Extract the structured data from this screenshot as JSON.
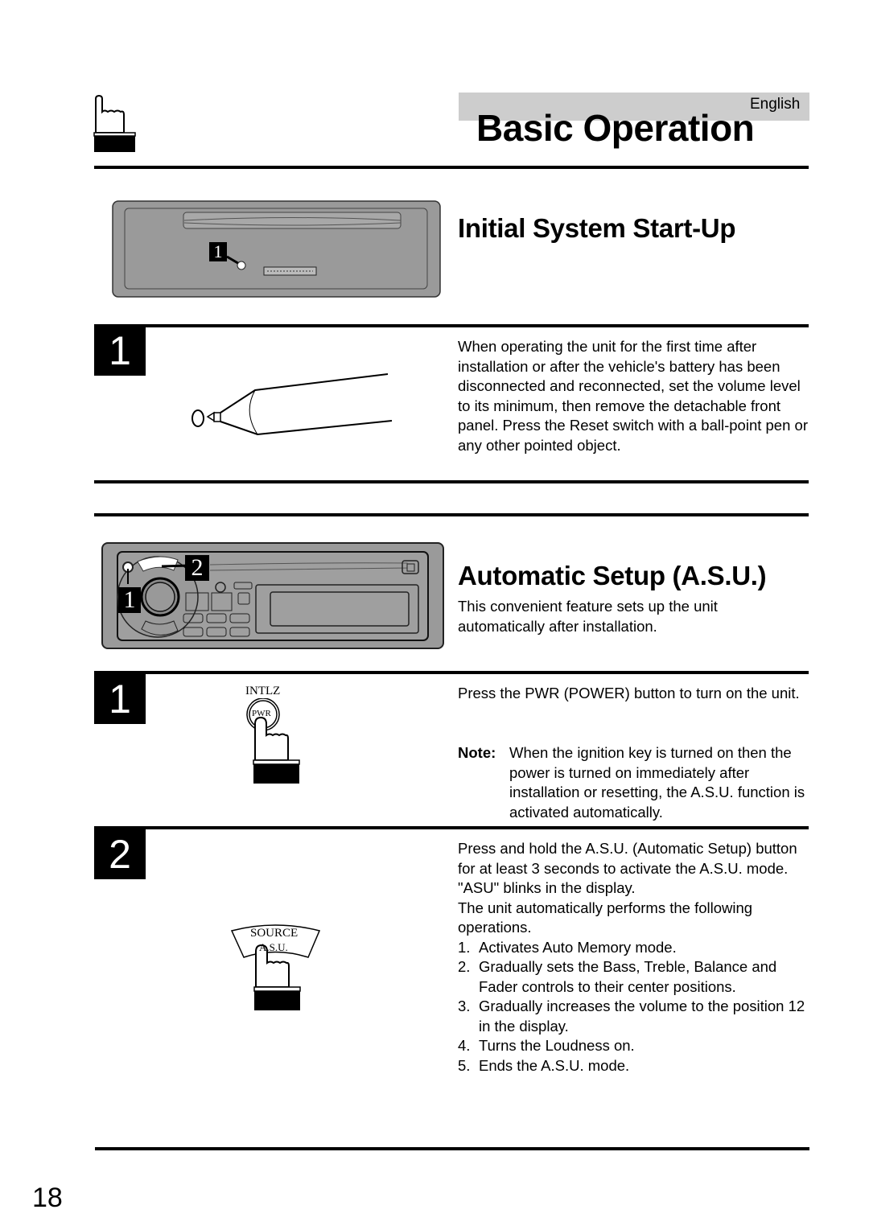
{
  "header": {
    "language": "English",
    "title": "Basic Operation"
  },
  "section1": {
    "title": "Initial System Start-Up",
    "figure_callout": "1",
    "steps": [
      {
        "number": "1",
        "text": "When operating the unit for the first time after installation or after the vehicle's battery has been disconnected and reconnected, set the volume level to its minimum, then remove the detachable front panel. Press the Reset switch with a ball-point pen or any other pointed object."
      }
    ]
  },
  "section2": {
    "title": "Automatic Setup (A.S.U.)",
    "intro": "This convenient feature sets up the unit automatically after installation.",
    "figure_callouts": [
      "1",
      "2"
    ],
    "steps": [
      {
        "number": "1",
        "button_top_label": "INTLZ",
        "button_label": "PWR",
        "text": "Press the PWR (POWER) button to turn on the unit.",
        "note_label": "Note:",
        "note_text": "When the ignition key is turned on then the power is turned on immediately after installation or resetting, the A.S.U. function is activated automatically."
      },
      {
        "number": "2",
        "button_label_line1": "SOURCE",
        "button_label_line2": "A.S.U.",
        "text_lines": [
          "Press and hold the A.S.U. (Automatic Setup) button for at least 3 seconds to activate the A.S.U. mode.",
          "\"ASU\" blinks in the display.",
          "The unit automatically performs the following operations."
        ],
        "list": [
          {
            "num": "1.",
            "text": "Activates Auto Memory mode."
          },
          {
            "num": "2.",
            "text": "Gradually sets the Bass, Treble, Balance and Fader controls to their center positions."
          },
          {
            "num": "3.",
            "text": "Gradually increases the volume to the position 12 in the display."
          },
          {
            "num": "4.",
            "text": "Turns the Loudness on."
          },
          {
            "num": "5.",
            "text": "Ends the A.S.U. mode."
          }
        ]
      }
    ]
  },
  "footer": {
    "page_number": "18"
  }
}
